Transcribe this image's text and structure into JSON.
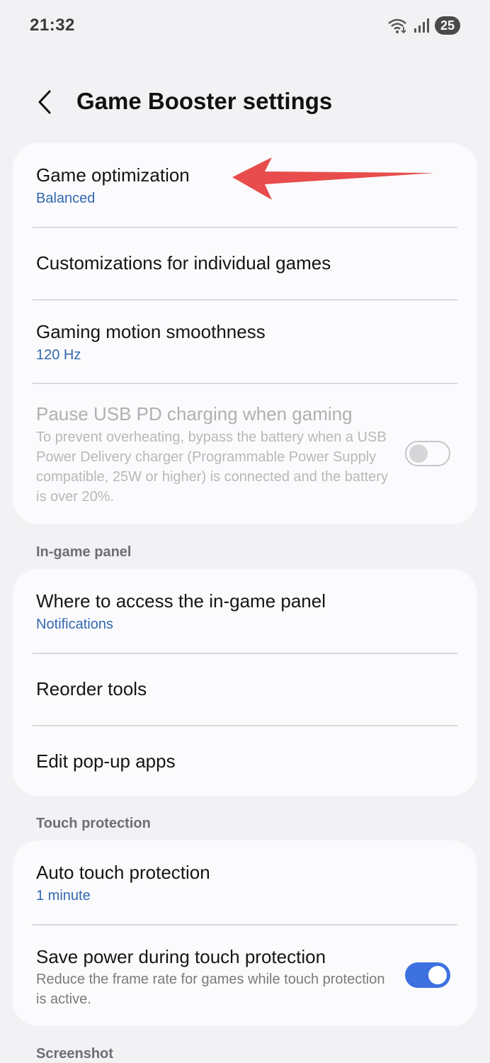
{
  "status_bar": {
    "time": "21:32",
    "battery": "25"
  },
  "header": {
    "title": "Game Booster settings"
  },
  "main_card": {
    "game_optimization": {
      "label": "Game optimization",
      "value": "Balanced"
    },
    "customizations": {
      "label": "Customizations for individual games"
    },
    "motion_smoothness": {
      "label": "Gaming motion smoothness",
      "value": "120 Hz"
    },
    "pause_usb": {
      "label": "Pause USB PD charging when gaming",
      "description": "To prevent overheating, bypass the battery when a USB Power Delivery charger (Programmable Power Supply compatible, 25W or higher) is connected and the battery is over 20%.",
      "enabled": false
    }
  },
  "in_game_panel": {
    "header": "In-game panel",
    "where_to_access": {
      "label": "Where to access the in-game panel",
      "value": "Notifications"
    },
    "reorder_tools": {
      "label": "Reorder tools"
    },
    "edit_popup_apps": {
      "label": "Edit pop-up apps"
    }
  },
  "touch_protection": {
    "header": "Touch protection",
    "auto": {
      "label": "Auto touch protection",
      "value": "1 minute"
    },
    "save_power": {
      "label": "Save power during touch protection",
      "description": "Reduce the frame rate for games while touch protection is active.",
      "enabled": true
    }
  },
  "screenshot_section": {
    "header": "Screenshot"
  },
  "colors": {
    "accent": "#3e71e0",
    "link": "#3468b0",
    "arrow": "#e84c4c"
  }
}
